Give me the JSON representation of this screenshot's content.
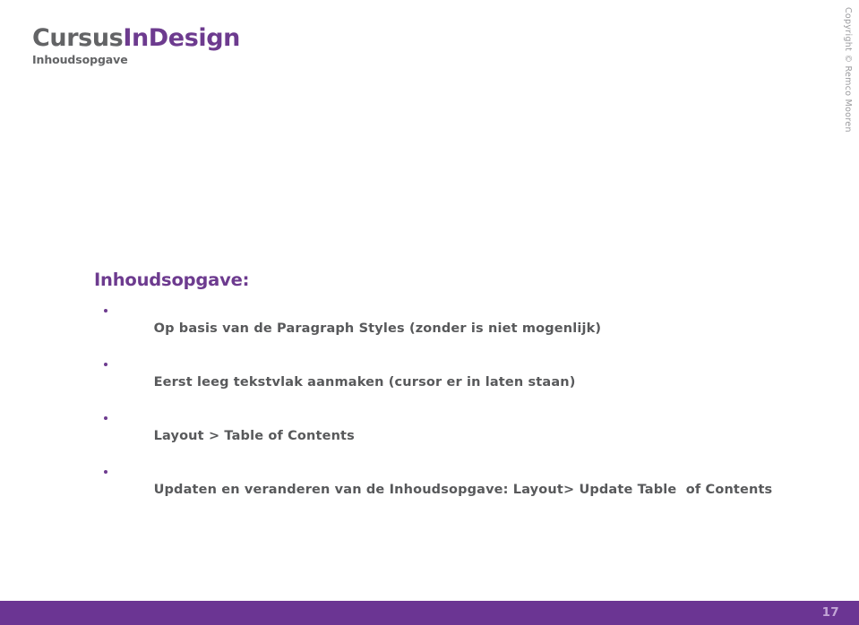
{
  "header": {
    "logo_text_gray": "Cursus",
    "logo_text_purple": "InDesign",
    "logo_subtitle": "Inhoudsopgave"
  },
  "copyright": {
    "text": "Copyright © Remco Mooren"
  },
  "main": {
    "heading": "Inhoudsopgave:",
    "bullets": [
      "Op basis van de Paragraph Styles (zonder is niet mogenlijk)",
      "Eerst leeg tekstvlak aanmaken (cursor er in laten staan)",
      "Layout > Table of Contents",
      "Updaten en veranderen van de Inhoudsopgave: Layout> Update Table  of Contents"
    ]
  },
  "footer": {
    "page_number": "17"
  },
  "colors": {
    "purple": "#6d3b8f",
    "footer_purple": "#6b3593",
    "gray_text": "#58595b",
    "logo_gray": "#636466",
    "page_number": "#c3a5d6",
    "background": "#ffffff"
  }
}
